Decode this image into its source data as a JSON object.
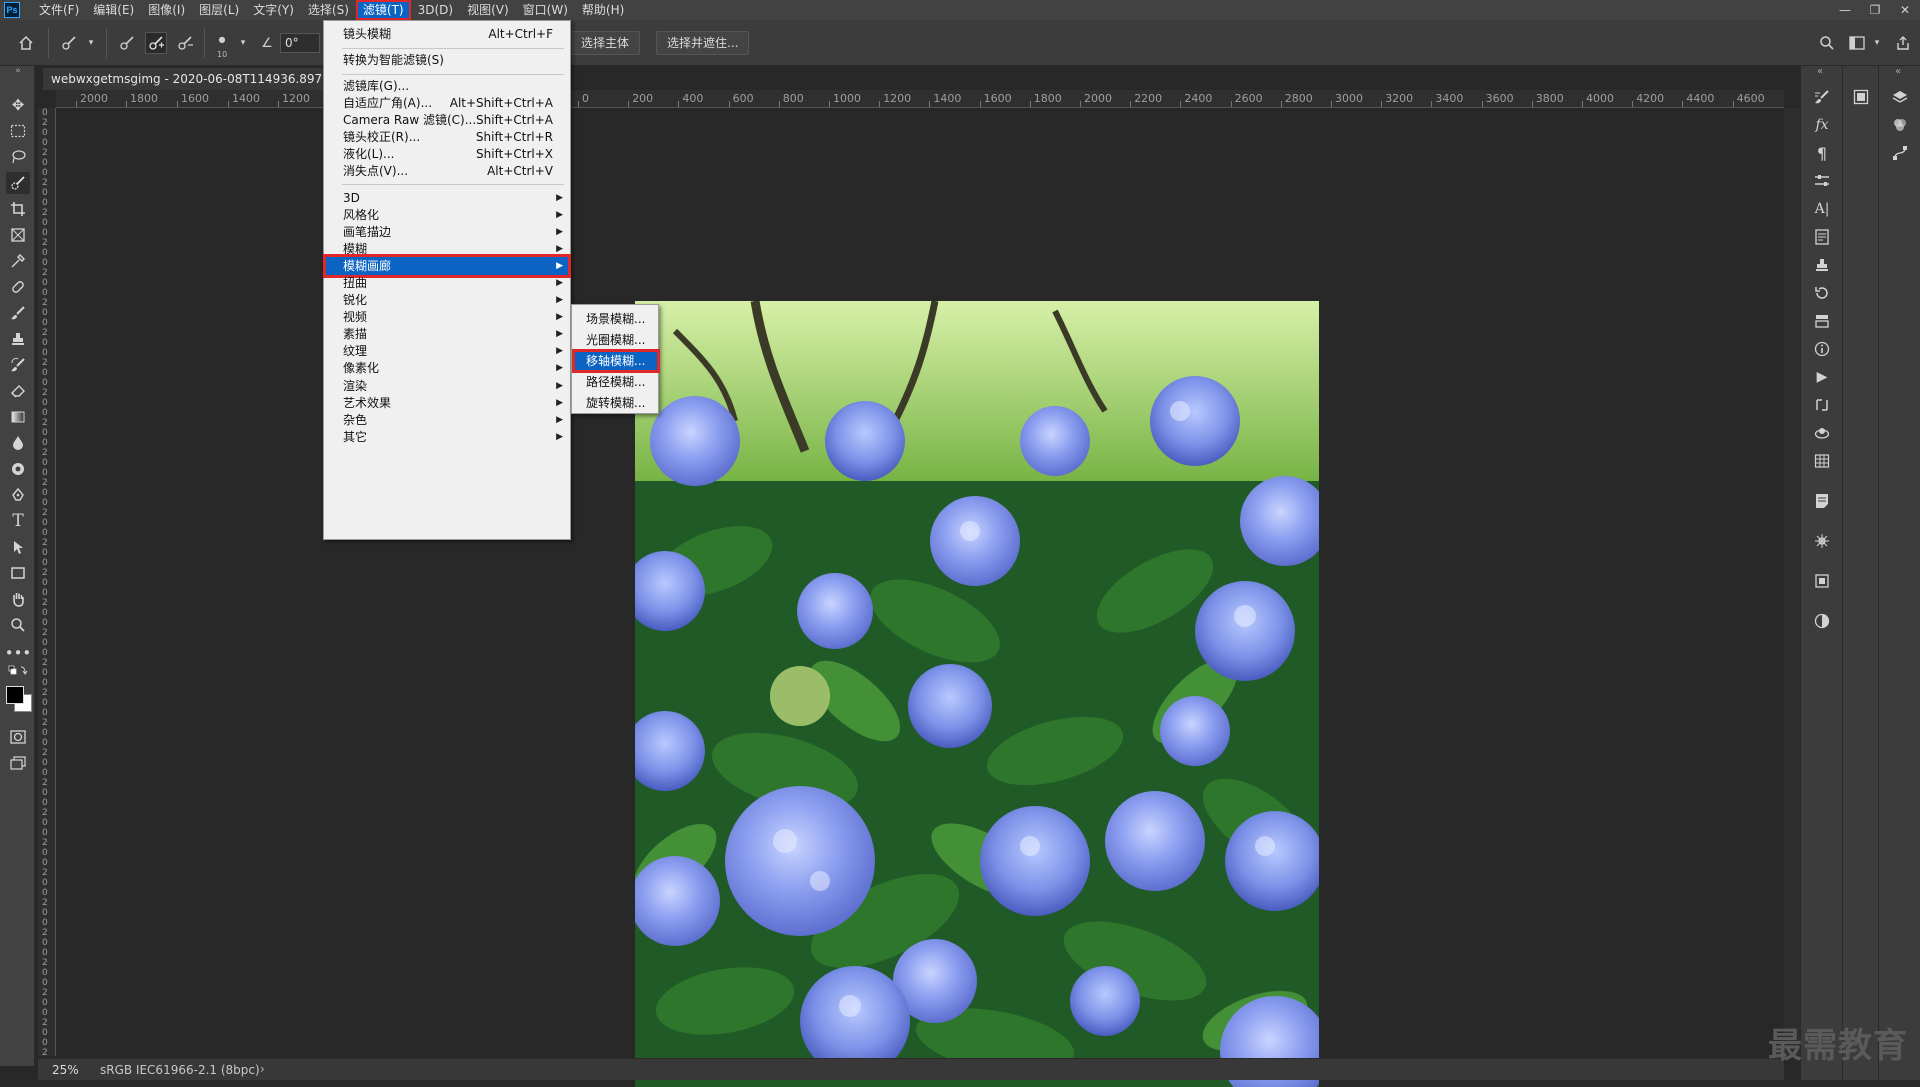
{
  "app": {
    "logo": "Ps"
  },
  "menubar": {
    "items": [
      "文件(F)",
      "编辑(E)",
      "图像(I)",
      "图层(L)",
      "文字(Y)",
      "选择(S)",
      "滤镜(T)",
      "3D(D)",
      "视图(V)",
      "窗口(W)",
      "帮助(H)"
    ],
    "active_index": 6
  },
  "window_controls": {
    "minimize": "—",
    "restore": "❐",
    "close": "✕"
  },
  "options_bar": {
    "brush_size": "10",
    "angle": "0°",
    "select_subject": "选择主体",
    "select_and_mask": "选择并遮住..."
  },
  "document": {
    "tab_title": "webwxgetmsgimg - 2020-06-08T114936.897.jpg",
    "zoom": "25%",
    "color_profile": "sRGB IEC61966-2.1 (8bpc)",
    "status_arrow": "›"
  },
  "ruler": {
    "labels_left": [
      "2000",
      "1800",
      "1600",
      "1400",
      "1200"
    ],
    "labels_right": [
      "0",
      "200",
      "400",
      "600",
      "800",
      "1000",
      "1200",
      "1400",
      "1600",
      "1800",
      "2000",
      "2200",
      "2400",
      "2600",
      "2800",
      "3000",
      "3200",
      "3400",
      "3600",
      "3800",
      "4000",
      "4200",
      "4400",
      "4600"
    ]
  },
  "filter_menu": {
    "items": [
      {
        "label": "镜头模糊",
        "shortcut": "Alt+Ctrl+F"
      },
      {
        "label": "转换为智能滤镜(S)",
        "shortcut": ""
      },
      {
        "label": "滤镜库(G)...",
        "shortcut": ""
      },
      {
        "label": "自适应广角(A)...",
        "shortcut": "Alt+Shift+Ctrl+A"
      },
      {
        "label": "Camera Raw 滤镜(C)...",
        "shortcut": "Shift+Ctrl+A"
      },
      {
        "label": "镜头校正(R)...",
        "shortcut": "Shift+Ctrl+R"
      },
      {
        "label": "液化(L)...",
        "shortcut": "Shift+Ctrl+X"
      },
      {
        "label": "消失点(V)...",
        "shortcut": "Alt+Ctrl+V"
      },
      {
        "label": "3D",
        "shortcut": ""
      },
      {
        "label": "风格化",
        "shortcut": ""
      },
      {
        "label": "画笔描边",
        "shortcut": ""
      },
      {
        "label": "模糊",
        "shortcut": ""
      },
      {
        "label": "模糊画廊",
        "shortcut": ""
      },
      {
        "label": "扭曲",
        "shortcut": ""
      },
      {
        "label": "锐化",
        "shortcut": ""
      },
      {
        "label": "视频",
        "shortcut": ""
      },
      {
        "label": "素描",
        "shortcut": ""
      },
      {
        "label": "纹理",
        "shortcut": ""
      },
      {
        "label": "像素化",
        "shortcut": ""
      },
      {
        "label": "渲染",
        "shortcut": ""
      },
      {
        "label": "艺术效果",
        "shortcut": ""
      },
      {
        "label": "杂色",
        "shortcut": ""
      },
      {
        "label": "其它",
        "shortcut": ""
      }
    ],
    "highlighted": "模糊画廊"
  },
  "blur_gallery_submenu": {
    "items": [
      "场景模糊...",
      "光圈模糊...",
      "移轴模糊...",
      "路径模糊...",
      "旋转模糊..."
    ],
    "highlighted": "移轴模糊..."
  },
  "watermark": "最需教育",
  "colors": {
    "menu_highlight": "#0b64c4",
    "annotation_red": "#e0282b",
    "ui_dark": "#282828",
    "panel": "#424242"
  }
}
